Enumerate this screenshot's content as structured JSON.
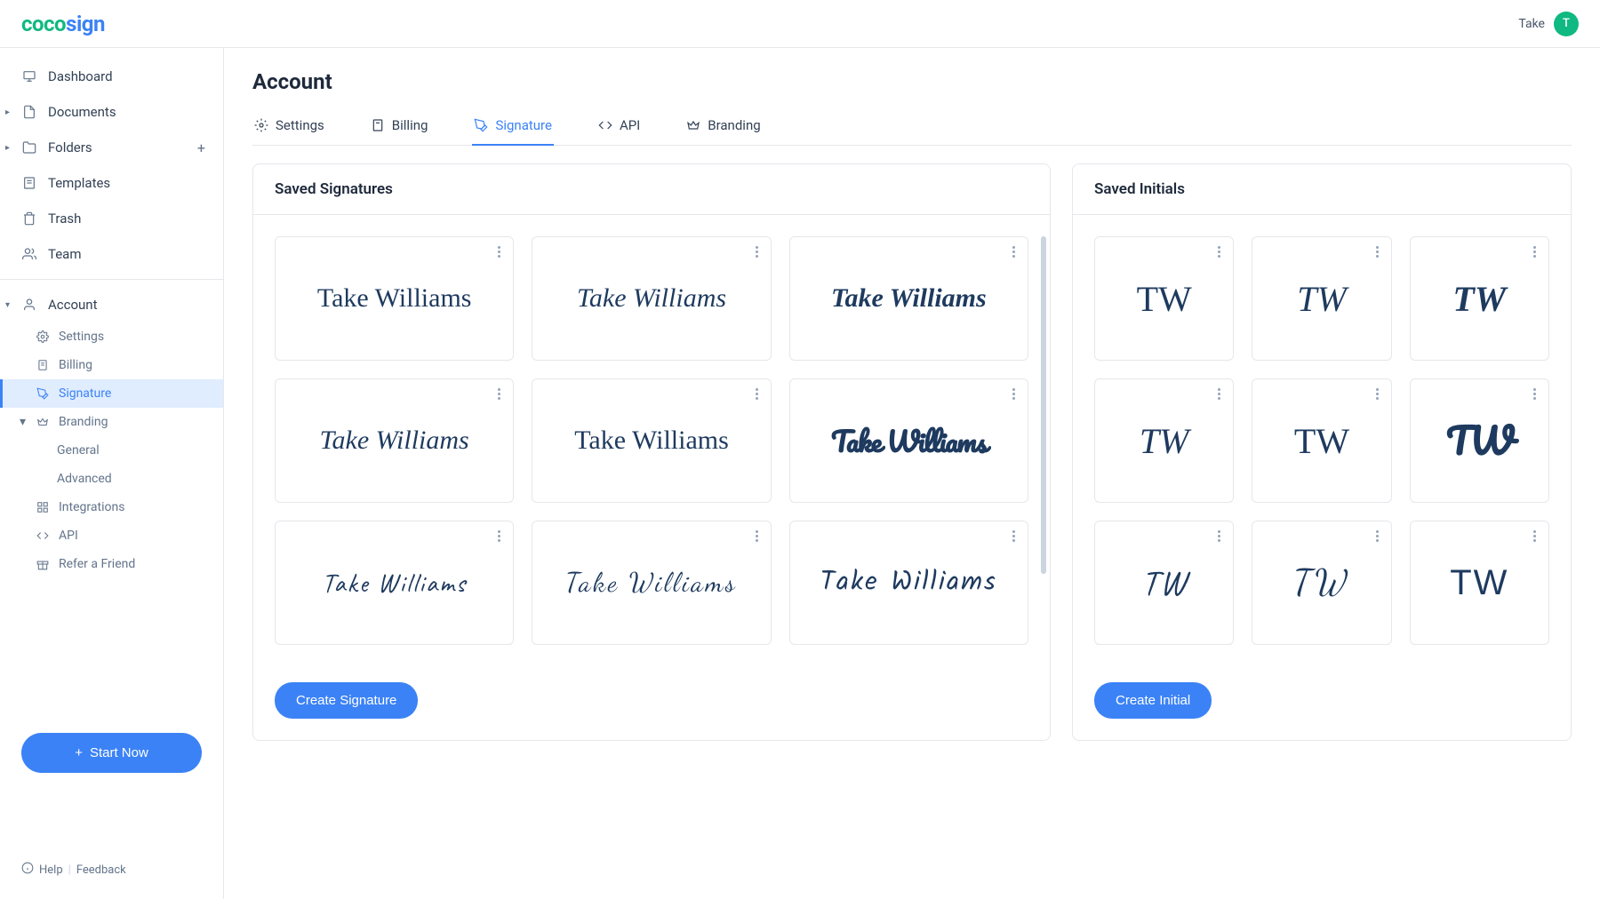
{
  "brand": {
    "part1": "coco",
    "part2": "sign"
  },
  "user": {
    "name": "Take",
    "initial": "T"
  },
  "sidebar": {
    "dashboard": "Dashboard",
    "documents": "Documents",
    "folders": "Folders",
    "templates": "Templates",
    "trash": "Trash",
    "team": "Team",
    "account": "Account",
    "settings": "Settings",
    "billing": "Billing",
    "signature": "Signature",
    "branding": "Branding",
    "general": "General",
    "advanced": "Advanced",
    "integrations": "Integrations",
    "api": "API",
    "refer": "Refer a Friend",
    "start_now": "Start Now"
  },
  "footer": {
    "help": "Help",
    "feedback": "Feedback"
  },
  "page": {
    "title": "Account"
  },
  "tabs": {
    "settings": "Settings",
    "billing": "Billing",
    "signature": "Signature",
    "api": "API",
    "branding": "Branding"
  },
  "signatures": {
    "heading": "Saved Signatures",
    "create": "Create Signature",
    "items": [
      {
        "text": "Take Williams"
      },
      {
        "text": "Take Williams"
      },
      {
        "text": "Take Williams"
      },
      {
        "text": "Take Williams"
      },
      {
        "text": "Take Williams"
      },
      {
        "text": "Take Williams"
      },
      {
        "text": "Take Williams"
      },
      {
        "text": "Take Williams"
      },
      {
        "text": "Take Williams"
      }
    ]
  },
  "initials": {
    "heading": "Saved Initials",
    "create": "Create Initial",
    "items": [
      {
        "text": "TW"
      },
      {
        "text": "TW"
      },
      {
        "text": "TW"
      },
      {
        "text": "TW"
      },
      {
        "text": "TW"
      },
      {
        "text": "TW"
      },
      {
        "text": "TW"
      },
      {
        "text": "TW"
      },
      {
        "text": "TW"
      }
    ]
  }
}
